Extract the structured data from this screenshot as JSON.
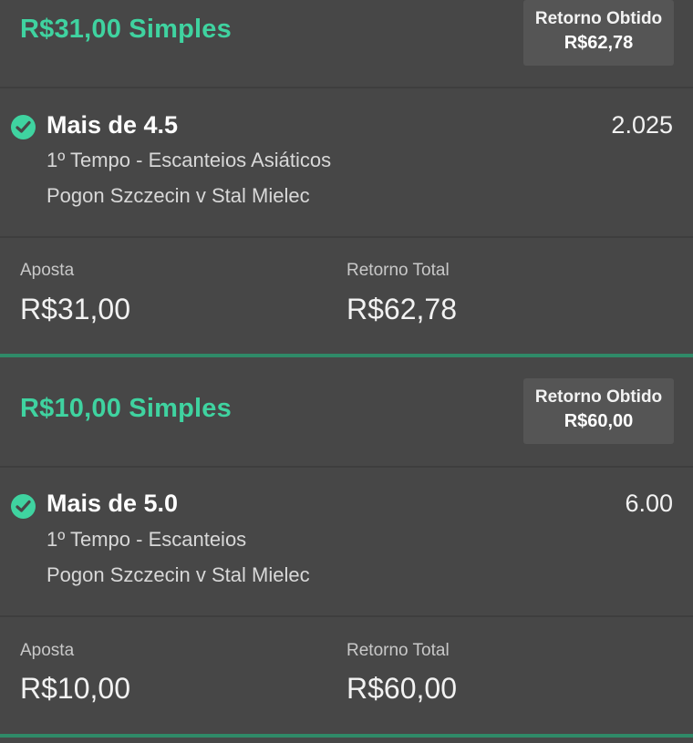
{
  "bets": [
    {
      "title": "R$31,00 Simples",
      "badge": {
        "label": "Retorno Obtido",
        "value": "R$62,78"
      },
      "selection": {
        "name": "Mais de 4.5",
        "odds": "2.025",
        "market": "1º Tempo - Escanteios Asiáticos",
        "event": "Pogon Szczecin v Stal Mielec",
        "status_icon": "check-circle-icon"
      },
      "stake": {
        "label": "Aposta",
        "value": "R$31,00"
      },
      "total": {
        "label": "Retorno Total",
        "value": "R$62,78"
      }
    },
    {
      "title": "R$10,00 Simples",
      "badge": {
        "label": "Retorno Obtido",
        "value": "R$60,00"
      },
      "selection": {
        "name": "Mais de 5.0",
        "odds": "6.00",
        "market": "1º Tempo - Escanteios",
        "event": "Pogon Szczecin v Stal Mielec",
        "status_icon": "check-circle-icon"
      },
      "stake": {
        "label": "Aposta",
        "value": "R$10,00"
      },
      "total": {
        "label": "Retorno Total",
        "value": "R$60,00"
      }
    }
  ],
  "colors": {
    "accent": "#3fd3a0",
    "background": "#474747",
    "badge_background": "#555555",
    "separator": "#2f8a68"
  }
}
